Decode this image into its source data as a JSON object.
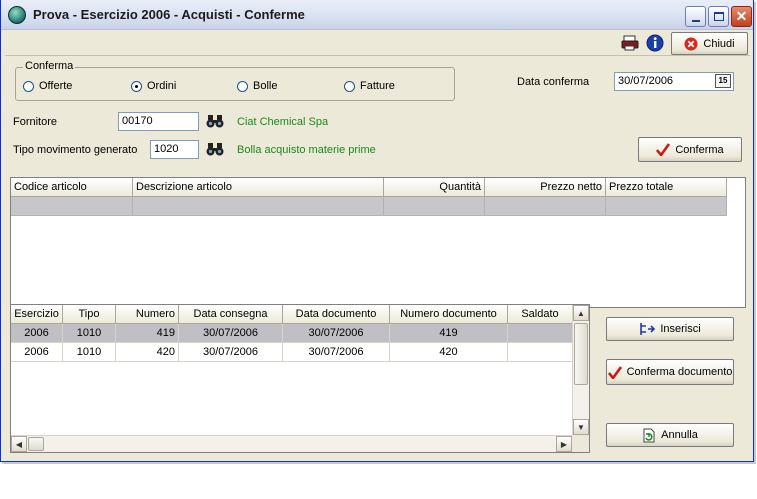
{
  "window": {
    "title": "Prova - Esercizio 2006 - Acquisti - Conferme",
    "controls": [
      "minimize-icon",
      "maximize-icon",
      "close-icon"
    ]
  },
  "toolbar": {
    "printer_icon": "printer-icon",
    "info_icon": "info-icon",
    "close_label": "Chiudi"
  },
  "conferma_group": {
    "legend": "Conferma",
    "options": [
      {
        "label": "Offerte",
        "selected": false
      },
      {
        "label": "Ordini",
        "selected": true
      },
      {
        "label": "Bolle",
        "selected": false
      },
      {
        "label": "Fatture",
        "selected": false
      }
    ]
  },
  "data_conferma": {
    "label": "Data conferma",
    "value": "30/07/2006",
    "calendar_icon": "calendar-icon",
    "calendar_glyph": "15"
  },
  "fornitore": {
    "label": "Fornitore",
    "value": "00170",
    "name": "Ciat Chemical Spa"
  },
  "tipo_movimento": {
    "label": "Tipo movimento generato",
    "value": "1020",
    "description": "Bolla acquisto materie prime"
  },
  "conferma_button": {
    "label": "Conferma"
  },
  "articoli_grid": {
    "headers": [
      "Codice articolo",
      "Descrizione articolo",
      "Quantità",
      "Prezzo netto",
      "Prezzo totale"
    ],
    "rows": [
      [
        "",
        "",
        "",
        "",
        ""
      ]
    ]
  },
  "documenti_grid": {
    "headers": [
      "Esercizio",
      "Tipo",
      "Numero",
      "Data consegna",
      "Data documento",
      "Numero documento",
      "Saldato"
    ],
    "rows": [
      [
        "2006",
        "1010",
        "419",
        "30/07/2006",
        "30/07/2006",
        "419",
        ""
      ],
      [
        "2006",
        "1010",
        "420",
        "30/07/2006",
        "30/07/2006",
        "420",
        ""
      ]
    ]
  },
  "side_buttons": {
    "inserisci": "Inserisci",
    "conferma_documento": "Conferma documento",
    "annulla": "Annulla"
  },
  "colors": {
    "window_bg": "#ece9d8",
    "link_green": "#1a8a1a",
    "selected_row": "#bfbfc4"
  }
}
